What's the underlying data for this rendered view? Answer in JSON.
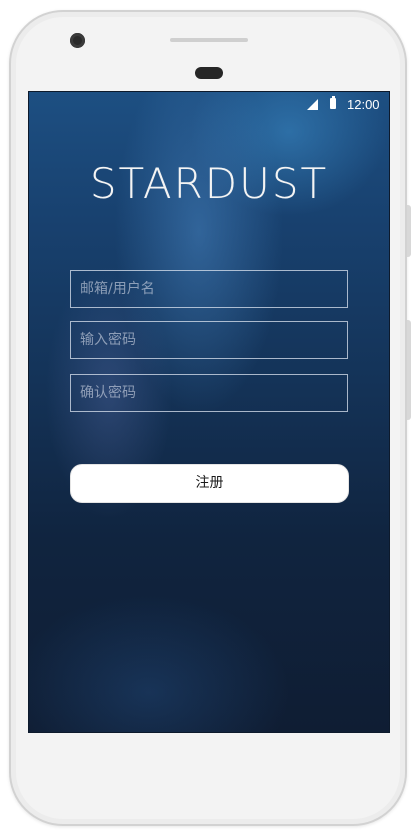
{
  "status_bar": {
    "time": "12:00",
    "signal_icon": "cell-signal-icon",
    "battery_icon": "battery-icon"
  },
  "app": {
    "logo_text": "STARDUST"
  },
  "form": {
    "username_placeholder": "邮箱/用户名",
    "password_placeholder": "输入密码",
    "confirm_placeholder": "确认密码",
    "username_value": "",
    "password_value": "",
    "confirm_value": ""
  },
  "register_button": {
    "label": "注册"
  },
  "colors": {
    "screen_top": "#1d4f82",
    "screen_bottom": "#0f1d33",
    "field_border": "#dce4f0",
    "button_bg": "#ffffff"
  }
}
